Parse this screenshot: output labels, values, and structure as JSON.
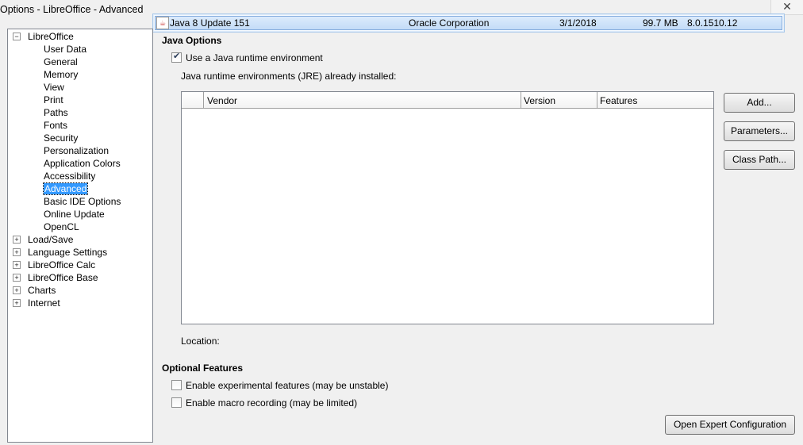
{
  "window": {
    "title": "Options - LibreOffice - Advanced",
    "close_glyph": "✕"
  },
  "overlay_row": {
    "name": "Java 8 Update 151",
    "vendor": "Oracle Corporation",
    "date": "3/1/2018",
    "size": "99.7 MB",
    "version": "8.0.1510.12"
  },
  "tree": {
    "root": "LibreOffice",
    "children": [
      "User Data",
      "General",
      "Memory",
      "View",
      "Print",
      "Paths",
      "Fonts",
      "Security",
      "Personalization",
      "Application Colors",
      "Accessibility",
      "Advanced",
      "Basic IDE Options",
      "Online Update",
      "OpenCL"
    ],
    "collapsed": [
      "Load/Save",
      "Language Settings",
      "LibreOffice Calc",
      "LibreOffice Base",
      "Charts",
      "Internet"
    ],
    "selected": "Advanced",
    "expander_open": "−",
    "expander_closed": "+"
  },
  "java_options": {
    "title": "Java Options",
    "use_jre_label": "Use a Java runtime environment",
    "use_jre_checked": true,
    "installed_label": "Java runtime environments (JRE) already installed:",
    "columns": [
      "Vendor",
      "Version",
      "Features"
    ],
    "location_label": "Location:",
    "buttons": {
      "add": "Add...",
      "parameters": "Parameters...",
      "class_path": "Class Path..."
    }
  },
  "optional_features": {
    "title": "Optional Features",
    "experimental_label": "Enable experimental features (may be unstable)",
    "experimental_checked": false,
    "macro_label": "Enable macro recording (may be limited)",
    "macro_checked": false
  },
  "expert_button": "Open Expert Configuration"
}
